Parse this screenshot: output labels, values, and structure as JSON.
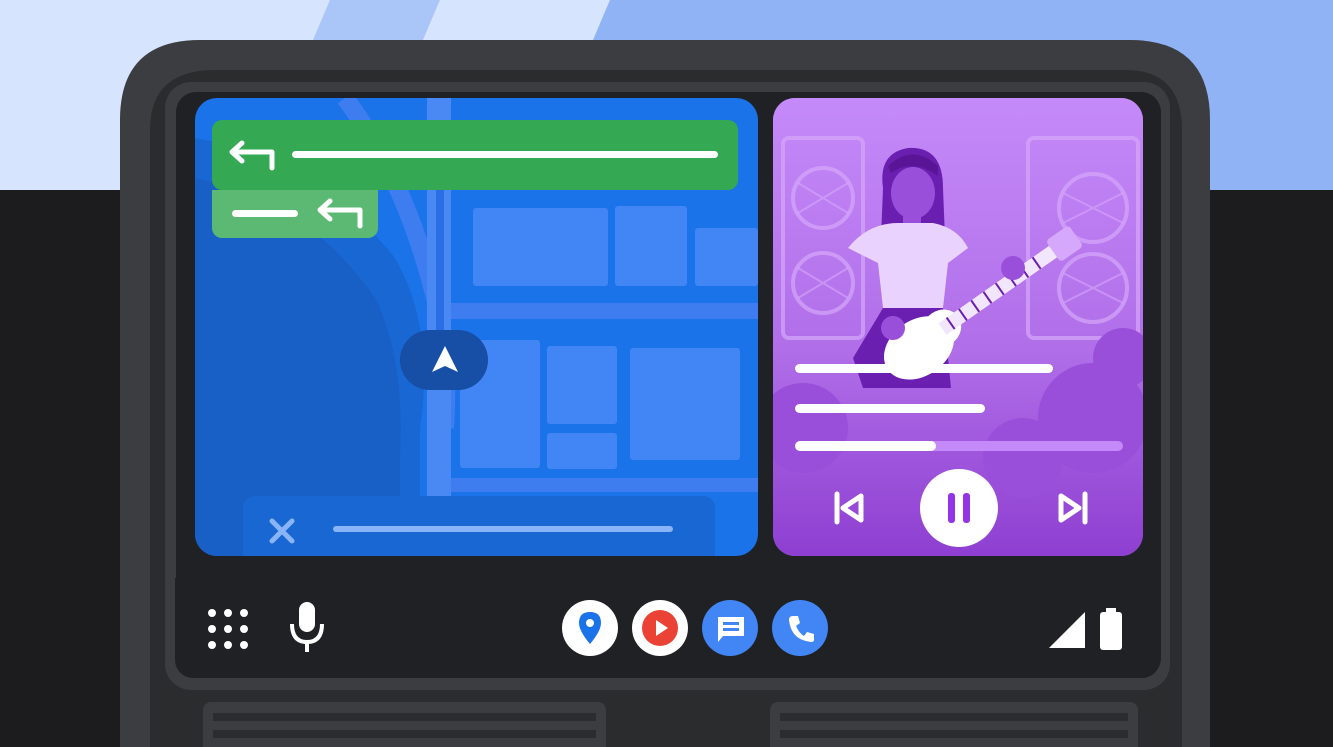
{
  "colors": {
    "sky": "#c8dafc",
    "dashboard": "#2b2c2e",
    "bezel": "#3c3d40",
    "map_background": "#1a73e8",
    "map_blocks": "#4285f4",
    "nav_banner": "#34a853",
    "next_turn": "#5bb974",
    "media_background": "#b67cf0",
    "media_accent": "#8e3fd1",
    "bottom_bar": "#202124"
  },
  "navigation": {
    "primary_turn_icon": "turn-left-arrow-icon",
    "next_turn_icon": "turn-left-arrow-icon",
    "position_marker_icon": "navigation-arrow-icon",
    "cancel_icon": "close-icon"
  },
  "media": {
    "illustration": "guitarist-singing",
    "progress": 0.43,
    "controls": {
      "previous_icon": "skip-previous-icon",
      "play_pause_icon": "pause-icon",
      "next_icon": "skip-next-icon"
    }
  },
  "bottom_bar": {
    "launcher_icon": "app-grid-icon",
    "voice_icon": "microphone-icon",
    "apps": [
      {
        "name": "maps",
        "icon": "maps-pin-icon",
        "color": "#1a73e8"
      },
      {
        "name": "youtube-music",
        "icon": "play-icon",
        "color": "#ea4335"
      },
      {
        "name": "messages",
        "icon": "message-icon",
        "color": "#4285f4"
      },
      {
        "name": "phone",
        "icon": "phone-icon",
        "color": "#4285f4"
      }
    ],
    "status": {
      "signal_icon": "signal-icon",
      "battery_icon": "battery-icon"
    }
  }
}
